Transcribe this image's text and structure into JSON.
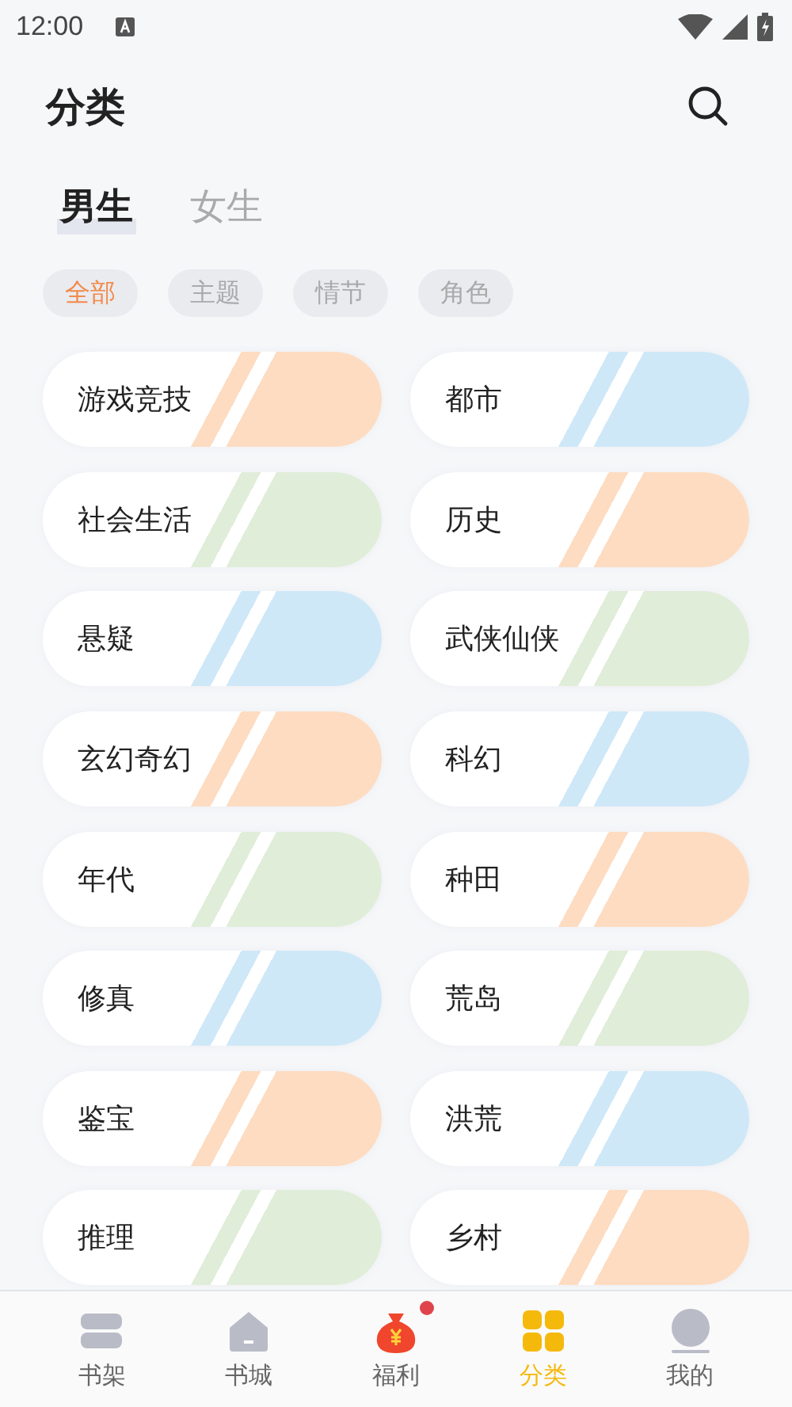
{
  "status_bar": {
    "time": "12:00"
  },
  "header": {
    "title": "分类"
  },
  "gender_tabs": [
    {
      "label": "男生",
      "selected": true
    },
    {
      "label": "女生",
      "selected": false
    }
  ],
  "filter_chips": [
    {
      "label": "全部",
      "selected": true
    },
    {
      "label": "主题",
      "selected": false
    },
    {
      "label": "情节",
      "selected": false
    },
    {
      "label": "角色",
      "selected": false
    }
  ],
  "categories": [
    {
      "label": "游戏竞技",
      "color": "#fddcc2"
    },
    {
      "label": "都市",
      "color": "#cfe8f8"
    },
    {
      "label": "社会生活",
      "color": "#e0edd9"
    },
    {
      "label": "历史",
      "color": "#fddcc2"
    },
    {
      "label": "悬疑",
      "color": "#cfe8f8"
    },
    {
      "label": "武侠仙侠",
      "color": "#e0edd9"
    },
    {
      "label": "玄幻奇幻",
      "color": "#fddcc2"
    },
    {
      "label": "科幻",
      "color": "#cfe8f8"
    },
    {
      "label": "年代",
      "color": "#e0edd9"
    },
    {
      "label": "种田",
      "color": "#fddcc2"
    },
    {
      "label": "修真",
      "color": "#cfe8f8"
    },
    {
      "label": "荒岛",
      "color": "#e0edd9"
    },
    {
      "label": "鉴宝",
      "color": "#fddcc2"
    },
    {
      "label": "洪荒",
      "color": "#cfe8f8"
    },
    {
      "label": "推理",
      "color": "#e0edd9"
    },
    {
      "label": "乡村",
      "color": "#fddcc2"
    }
  ],
  "bottom_nav": [
    {
      "kind": "shelf",
      "label": "书架",
      "selected": false,
      "badge": false
    },
    {
      "kind": "store",
      "label": "书城",
      "selected": false,
      "badge": false
    },
    {
      "kind": "bonus",
      "label": "福利",
      "selected": false,
      "badge": true
    },
    {
      "kind": "category",
      "label": "分类",
      "selected": true,
      "badge": false
    },
    {
      "kind": "profile",
      "label": "我的",
      "selected": false,
      "badge": false
    }
  ]
}
